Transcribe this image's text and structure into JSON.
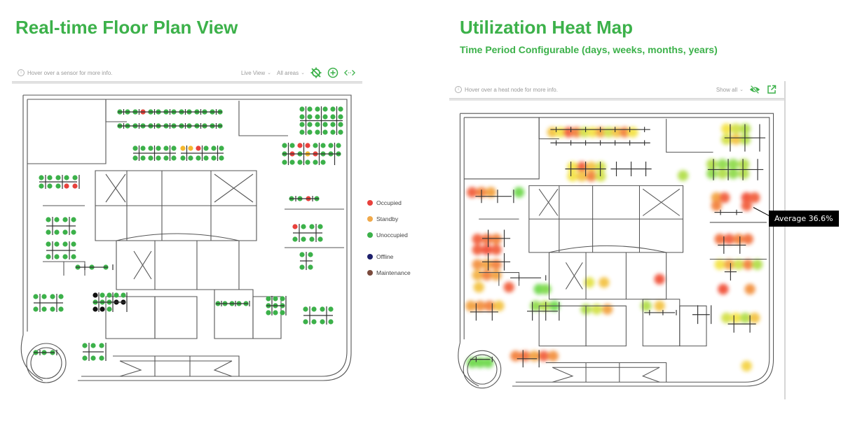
{
  "left": {
    "title": "Real-time Floor Plan View",
    "toolbar": {
      "hint": "Hover over a sensor for more info.",
      "view_dropdown": "Live View",
      "area_dropdown": "All areas",
      "icons": [
        "locate-off-icon",
        "zoom-in-icon",
        "expand-horizontal-icon"
      ]
    },
    "legend": [
      {
        "label": "Occupied",
        "color": "#e8413c"
      },
      {
        "label": "Standby",
        "color": "#f0a94a"
      },
      {
        "label": "Unoccupied",
        "color": "#3cb14a"
      },
      {
        "label": "Offline",
        "color": "#1d1f6b"
      },
      {
        "label": "Maintenance",
        "color": "#7a4a3c"
      }
    ],
    "status_colors": {
      "O": "#e8413c",
      "S": "#f5b82e",
      "U": "#3cb14a",
      "K": "#111111"
    },
    "clusters": {
      "top_row_1": "UUUUUUUUUUUUUUUUUOUUUUUUUUUU",
      "top_row_2": "UUUUUSUUUUUOUUUUUUUUUUUUUUUU",
      "top_right": "UUUUUUUUUUUUUUUUUUUUUUUU",
      "mid_left_a": "UUUUUUUUUUUU",
      "mid_mid": "SSOUUUUUUUUU",
      "mid_right": "UUOOUUUUUOUSOUUUUUUUUU",
      "left_small": "UUUUUUUUOO",
      "left_block_1": "UUUUUUUU",
      "left_block_2": "UUUUUUUU",
      "left_block_3": "UUUUUUUU",
      "right_block_1": "OUUUUUUU",
      "right_block_2": "UUUU",
      "right_block_3": "UUUUUUUU",
      "right_small": "UUOU",
      "bottom_block": "UUUUUU",
      "round_room": "UUU",
      "conf_a": "KUUUUUUUKKKKU",
      "conf_b": "UUUUUUUUU",
      "conf_c": "UUUUU",
      "offices": "UUU"
    }
  },
  "right": {
    "title": "Utilization Heat Map",
    "subtitle": "Time Period Configurable (days, weeks, months, years)",
    "toolbar": {
      "hint": "Hover over a heat node for more info.",
      "filter_dropdown": "Show all",
      "icons": [
        "visibility-off-icon",
        "open-external-icon"
      ]
    },
    "tooltip": "Average 36.6%",
    "heat_scale": {
      "low": "#39d13a",
      "mid": "#f3e032",
      "high": "#ef2a22"
    },
    "zones": {
      "top_row": [
        0.6,
        0.5,
        0.9,
        0.8,
        0.4,
        0.5,
        0.7,
        0.4,
        0.6,
        0.8,
        0.5
      ],
      "top_right": [
        0.5,
        0.4,
        0.3,
        0.4,
        0.6,
        0.3
      ],
      "mid_left": [
        0.5,
        0.9,
        0.6,
        0.4,
        0.5,
        0.6,
        0.8,
        0.4
      ],
      "mid_right": [
        0.3,
        0.2,
        0.2,
        0.3,
        0.2,
        0.3,
        0.2,
        0.3
      ],
      "right_small_a": [
        0.7,
        0.9,
        0.8
      ],
      "right_small_b": [
        0.95,
        0.9,
        0.9
      ],
      "left_block_1": [
        0.9,
        0.85,
        0.8,
        0.9,
        0.95,
        0.9
      ],
      "left_block_2": [
        0.75,
        0.7,
        0.8,
        0.65,
        0.8,
        0.7
      ],
      "left_block_3": [
        0.7,
        0.75,
        0.8,
        0.6
      ],
      "left_top_a": [
        0.9,
        0.8,
        0.7
      ],
      "left_top_b": [
        0.1
      ],
      "left_offices": [
        0.6,
        0.9
      ],
      "right_block_1": [
        0.85,
        0.9,
        0.8,
        0.85
      ],
      "right_block_2": [
        0.5,
        0.7,
        0.4,
        0.8,
        0.3
      ],
      "right_block_3": [
        0.4,
        0.5,
        0.3,
        0.6
      ],
      "right_offices": [
        0.95,
        0.75
      ],
      "center_hot": [
        0.95
      ],
      "conf_left": [
        0.2,
        0.3,
        0.1
      ],
      "conf_mid": [
        0.45,
        0.6
      ],
      "conf_right": [
        0.3,
        0.4,
        0.7
      ],
      "small_conf": [
        0.1,
        0.15
      ],
      "bottom_block": [
        0.8,
        0.85,
        0.7,
        0.9,
        0.75
      ],
      "round_room": [
        0.1,
        0.1,
        0.1
      ],
      "corner_right": [
        0.55
      ],
      "center_left_room": [
        0.3,
        0.6
      ],
      "mid_single": [
        0.3
      ]
    }
  }
}
